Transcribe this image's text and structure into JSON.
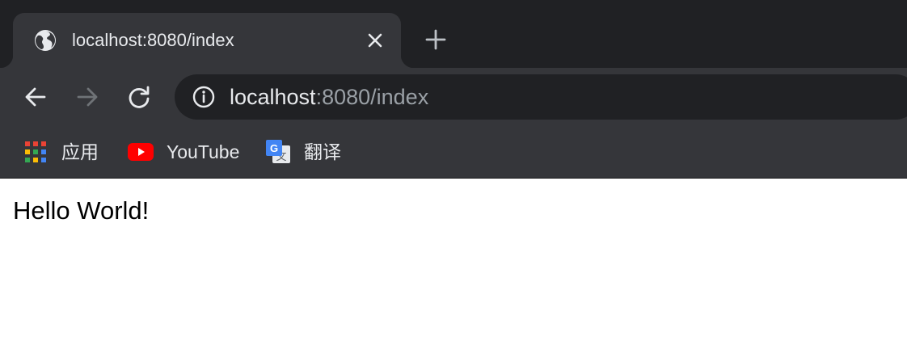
{
  "tab": {
    "title": "localhost:8080/index",
    "favicon": "globe-icon",
    "close": "close-icon"
  },
  "new_tab": "plus-icon",
  "toolbar": {
    "back": "arrow-left-icon",
    "forward": "arrow-right-icon",
    "forward_enabled": false,
    "reload": "reload-icon",
    "info": "info-icon",
    "url_host": "localhost",
    "url_rest": ":8080/index"
  },
  "bookmarks": [
    {
      "label": "应用",
      "icon": "apps-grid-icon"
    },
    {
      "label": "YouTube",
      "icon": "youtube-icon"
    },
    {
      "label": "翻译",
      "icon": "google-translate-icon"
    }
  ],
  "page": {
    "text": "Hello World!"
  },
  "colors": {
    "tabstrip_bg": "#202124",
    "toolbar_bg": "#35363a",
    "text_light": "#e8eaed",
    "text_dim": "#9aa0a6",
    "youtube_red": "#ff0000"
  }
}
